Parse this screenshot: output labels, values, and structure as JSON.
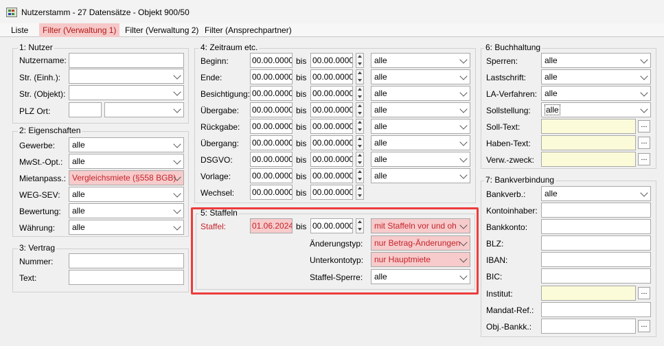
{
  "window": {
    "title": "Nutzerstamm - 27 Datensätze - Objekt 900/50"
  },
  "tabs": [
    "Liste",
    "Filter (Verwaltung 1)",
    "Filter (Verwaltung 2)",
    "Filter (Ansprechpartner)"
  ],
  "nutzer": {
    "group": "1: Nutzer",
    "rows": [
      {
        "label": "Nutzername:",
        "value": ""
      },
      {
        "label": "Str. (Einh.):",
        "value": ""
      },
      {
        "label": "Str. (Objekt):",
        "value": ""
      },
      {
        "label": "PLZ Ort:",
        "plz": "",
        "ort": ""
      }
    ]
  },
  "eigenschaften": {
    "group": "2: Eigenschaften",
    "rows": [
      {
        "label": "Gewerbe:",
        "value": "alle"
      },
      {
        "label": "MwSt.-Opt.:",
        "value": "alle"
      },
      {
        "label": "Mietanpass.:",
        "value": "Vergleichsmiete (§558 BGB)"
      },
      {
        "label": "WEG-SEV:",
        "value": "alle"
      },
      {
        "label": "Bewertung:",
        "value": "alle"
      },
      {
        "label": "Währung:",
        "value": "alle"
      }
    ]
  },
  "vertrag": {
    "group": "3: Vertrag",
    "rows": [
      {
        "label": "Nummer:",
        "value": ""
      },
      {
        "label": "Text:",
        "value": ""
      }
    ]
  },
  "zeitraum": {
    "group": "4: Zeitraum etc.",
    "bis": "bis",
    "rows": [
      {
        "label": "Beginn:",
        "from": "00.00.0000",
        "to": "00.00.0000",
        "option": "alle"
      },
      {
        "label": "Ende:",
        "from": "00.00.0000",
        "to": "00.00.0000",
        "option": "alle"
      },
      {
        "label": "Besichtigung:",
        "from": "00.00.0000",
        "to": "00.00.0000",
        "option": "alle"
      },
      {
        "label": "Übergabe:",
        "from": "00.00.0000",
        "to": "00.00.0000",
        "option": "alle"
      },
      {
        "label": "Rückgabe:",
        "from": "00.00.0000",
        "to": "00.00.0000",
        "option": "alle"
      },
      {
        "label": "Übergang:",
        "from": "00.00.0000",
        "to": "00.00.0000",
        "option": "alle"
      },
      {
        "label": "DSGVO:",
        "from": "00.00.0000",
        "to": "00.00.0000",
        "option": "alle"
      },
      {
        "label": "Vorlage:",
        "from": "00.00.0000",
        "to": "00.00.0000",
        "option": "alle"
      },
      {
        "label": "Wechsel:",
        "from": "00.00.0000",
        "to": "00.00.0000"
      }
    ]
  },
  "staffeln": {
    "group": "5: Staffeln",
    "staffel_label": "Staffel:",
    "staffel_from": "01.06.2024",
    "bis": "bis",
    "staffel_to": "00.00.0000",
    "staffel_option": "mit Staffeln vor und oh",
    "aenderungstyp_label": "Änderungstyp:",
    "aenderungstyp_value": "nur Betrag-Änderungen",
    "unterkontotyp_label": "Unterkontotyp:",
    "unterkontotyp_value": "nur Hauptmiete",
    "sperre_label": "Staffel-Sperre:",
    "sperre_value": "alle"
  },
  "buchhaltung": {
    "group": "6: Buchhaltung",
    "selects": [
      {
        "label": "Sperren:",
        "value": "alle"
      },
      {
        "label": "Lastschrift:",
        "value": "alle"
      },
      {
        "label": "LA-Verfahren:",
        "value": "alle"
      },
      {
        "label": "Sollstellung:",
        "value": "alle"
      }
    ],
    "texts": [
      {
        "label": "Soll-Text:",
        "value": ""
      },
      {
        "label": "Haben-Text:",
        "value": ""
      },
      {
        "label": "Verw.-zweck:",
        "value": ""
      }
    ]
  },
  "bankverbindung": {
    "group": "7: Bankverbindung",
    "bankverb_label": "Bankverb.:",
    "bankverb_value": "alle",
    "rows": [
      {
        "label": "Kontoinhaber:",
        "value": ""
      },
      {
        "label": "Bankkonto:",
        "value": ""
      },
      {
        "label": "BLZ:",
        "value": ""
      },
      {
        "label": "IBAN:",
        "value": ""
      },
      {
        "label": "BIC:",
        "value": ""
      },
      {
        "label": "Institut:",
        "value": ""
      },
      {
        "label": "Mandat-Ref.:",
        "value": ""
      },
      {
        "label": "Obj.-Bankk.:",
        "value": ""
      }
    ]
  },
  "ellipsis": "..."
}
